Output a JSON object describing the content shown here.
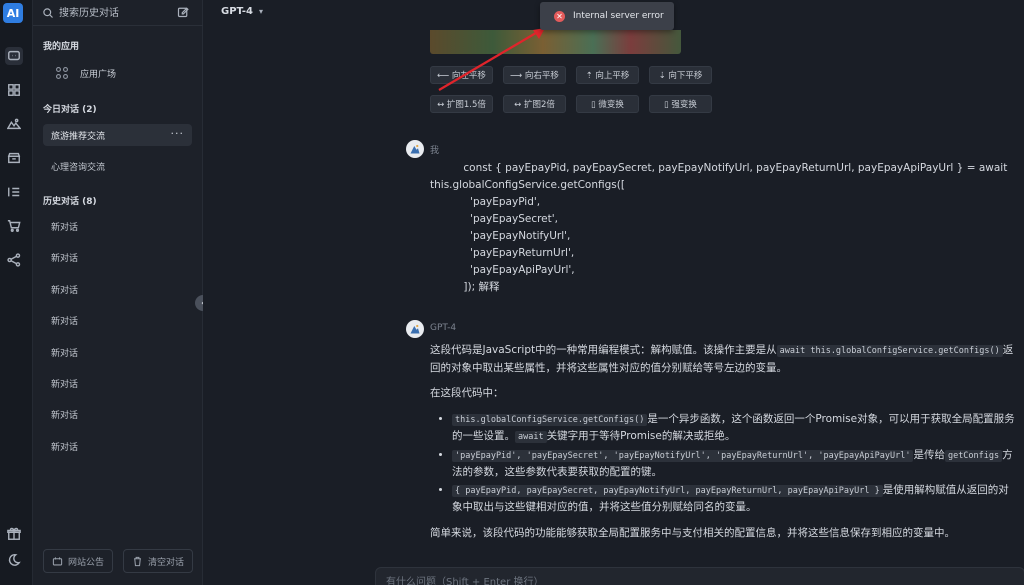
{
  "rail": {
    "logo": "AI",
    "icons": [
      "chat-icon",
      "apps-icon",
      "image-icon",
      "store-icon",
      "list-icon",
      "cart-icon",
      "share-icon",
      "gift-icon",
      "moon-icon"
    ]
  },
  "sidebar": {
    "search_placeholder": "搜索历史对话",
    "my_apps_title": "我的应用",
    "app_plaza_label": "应用广场",
    "today_title": "今日对话 (2)",
    "today_items": [
      "旅游推荐交流",
      "心理咨询交流"
    ],
    "history_title": "历史对话 (8)",
    "history_items": [
      "新对话",
      "新对话",
      "新对话",
      "新对话",
      "新对话",
      "新对话",
      "新对话",
      "新对话"
    ],
    "announcement_label": "网站公告",
    "clear_label": "清空对话"
  },
  "header": {
    "model": "GPT-4"
  },
  "toast": {
    "message": "Internal server error"
  },
  "actions": {
    "row1": [
      "⟵ 向左平移",
      "⟶ 向右平移",
      "⇡ 向上平移",
      "⇣ 向下平移"
    ],
    "row2": [
      "↔ 扩图1.5倍",
      "↔ 扩图2倍",
      "▯ 微变换",
      "▯ 强变换"
    ]
  },
  "user_message": {
    "sender": "我",
    "text": "          const { payEpayPid, payEpaySecret, payEpayNotifyUrl, payEpayReturnUrl, payEpayApiPayUrl } = await\nthis.globalConfigService.getConfigs([\n            'payEpayPid',\n            'payEpaySecret',\n            'payEpayNotifyUrl',\n            'payEpayReturnUrl',\n            'payEpayApiPayUrl',\n          ]); 解释"
  },
  "assistant_message": {
    "sender": "GPT-4",
    "p1_a": "这段代码是JavaScript中的一种常用编程模式：解构赋值。该操作主要是从",
    "p1_code": "await this.globalConfigService.getConfigs()",
    "p1_b": "返回的对象中取出某些属性，并将这些属性对应的值分别赋给等号左边的变量。",
    "p2": "在这段代码中：",
    "li1_code": "this.globalConfigService.getConfigs()",
    "li1_a": "是一个异步函数，这个函数返回一个Promise对象，可以用于获取全局配置服务的一些设置。",
    "li1_code2": "await",
    "li1_b": "关键字用于等待Promise的解决或拒绝。",
    "li2_code": "'payEpayPid', 'payEpaySecret', 'payEpayNotifyUrl', 'payEpayReturnUrl', 'payEpayApiPayUrl'",
    "li2_a": "是传给",
    "li2_code2": "getConfigs",
    "li2_b": "方法的参数，这些参数代表要获取的配置的键。",
    "li3_code": "{ payEpayPid, payEpaySecret, payEpayNotifyUrl, payEpayReturnUrl, payEpayApiPayUrl }",
    "li3_a": "是使用解构赋值从返回的对象中取出与这些键相对应的值，并将这些值分别赋给同名的变量。",
    "p3": "简单来说，该段代码的功能能够获取全局配置服务中与支付相关的配置信息，并将这些信息保存到相应的变量中。"
  },
  "chat_input": {
    "placeholder": "有什么问题（Shift + Enter 换行）"
  },
  "colors": {
    "accent": "#2f7de1",
    "error": "#e35b5b",
    "arrow": "#e0242b"
  }
}
